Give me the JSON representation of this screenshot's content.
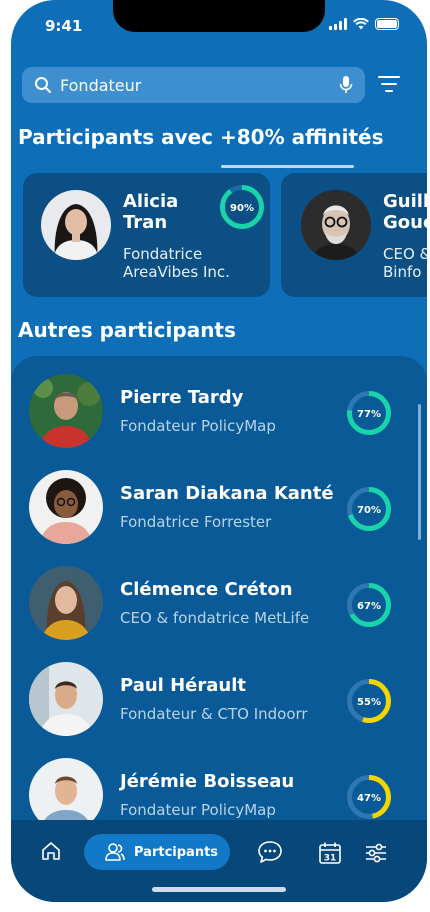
{
  "status": {
    "time": "9:41"
  },
  "search": {
    "value": "Fondateur"
  },
  "top_section": {
    "title": "Participants avec +80% affinités",
    "cards": [
      {
        "first": "Alicia",
        "last": "Tran",
        "role1": "Fondatrice",
        "role2": "AreaVibes Inc.",
        "affinity": 90,
        "affinity_label": "90%"
      },
      {
        "first": "Guill",
        "last": "Gouc",
        "role1": "CEO &",
        "role2": "Binfo",
        "affinity": null,
        "affinity_label": ""
      }
    ]
  },
  "others_section": {
    "title": "Autres participants",
    "rows": [
      {
        "name": "Pierre Tardy",
        "role": "Fondateur PolicyMap",
        "affinity": 77,
        "affinity_label": "77%",
        "color": "#19d3a9"
      },
      {
        "name": "Saran Diakana Kanté",
        "role": "Fondatrice Forrester",
        "affinity": 70,
        "affinity_label": "70%",
        "color": "#19d3a9"
      },
      {
        "name": "Clémence Créton",
        "role": " CEO & fondatrice MetLife",
        "affinity": 67,
        "affinity_label": "67%",
        "color": "#19d3a9"
      },
      {
        "name": "Paul Hérault",
        "role": "Fondateur & CTO Indoorr",
        "affinity": 55,
        "affinity_label": "55%",
        "color": "#f3d600"
      },
      {
        "name": "Jérémie Boisseau",
        "role": "Fondateur PolicyMap",
        "affinity": 47,
        "affinity_label": "47%",
        "color": "#f3d600"
      }
    ]
  },
  "tabbar": {
    "active_label": "Partcipants",
    "calendar_day": "31"
  },
  "colors": {
    "background": "#0e6fb8",
    "panel": "#0a5a98",
    "card": "#0b4f85",
    "tabbar": "#08477a",
    "accent": "#19d3a9",
    "warning": "#f3d600"
  }
}
